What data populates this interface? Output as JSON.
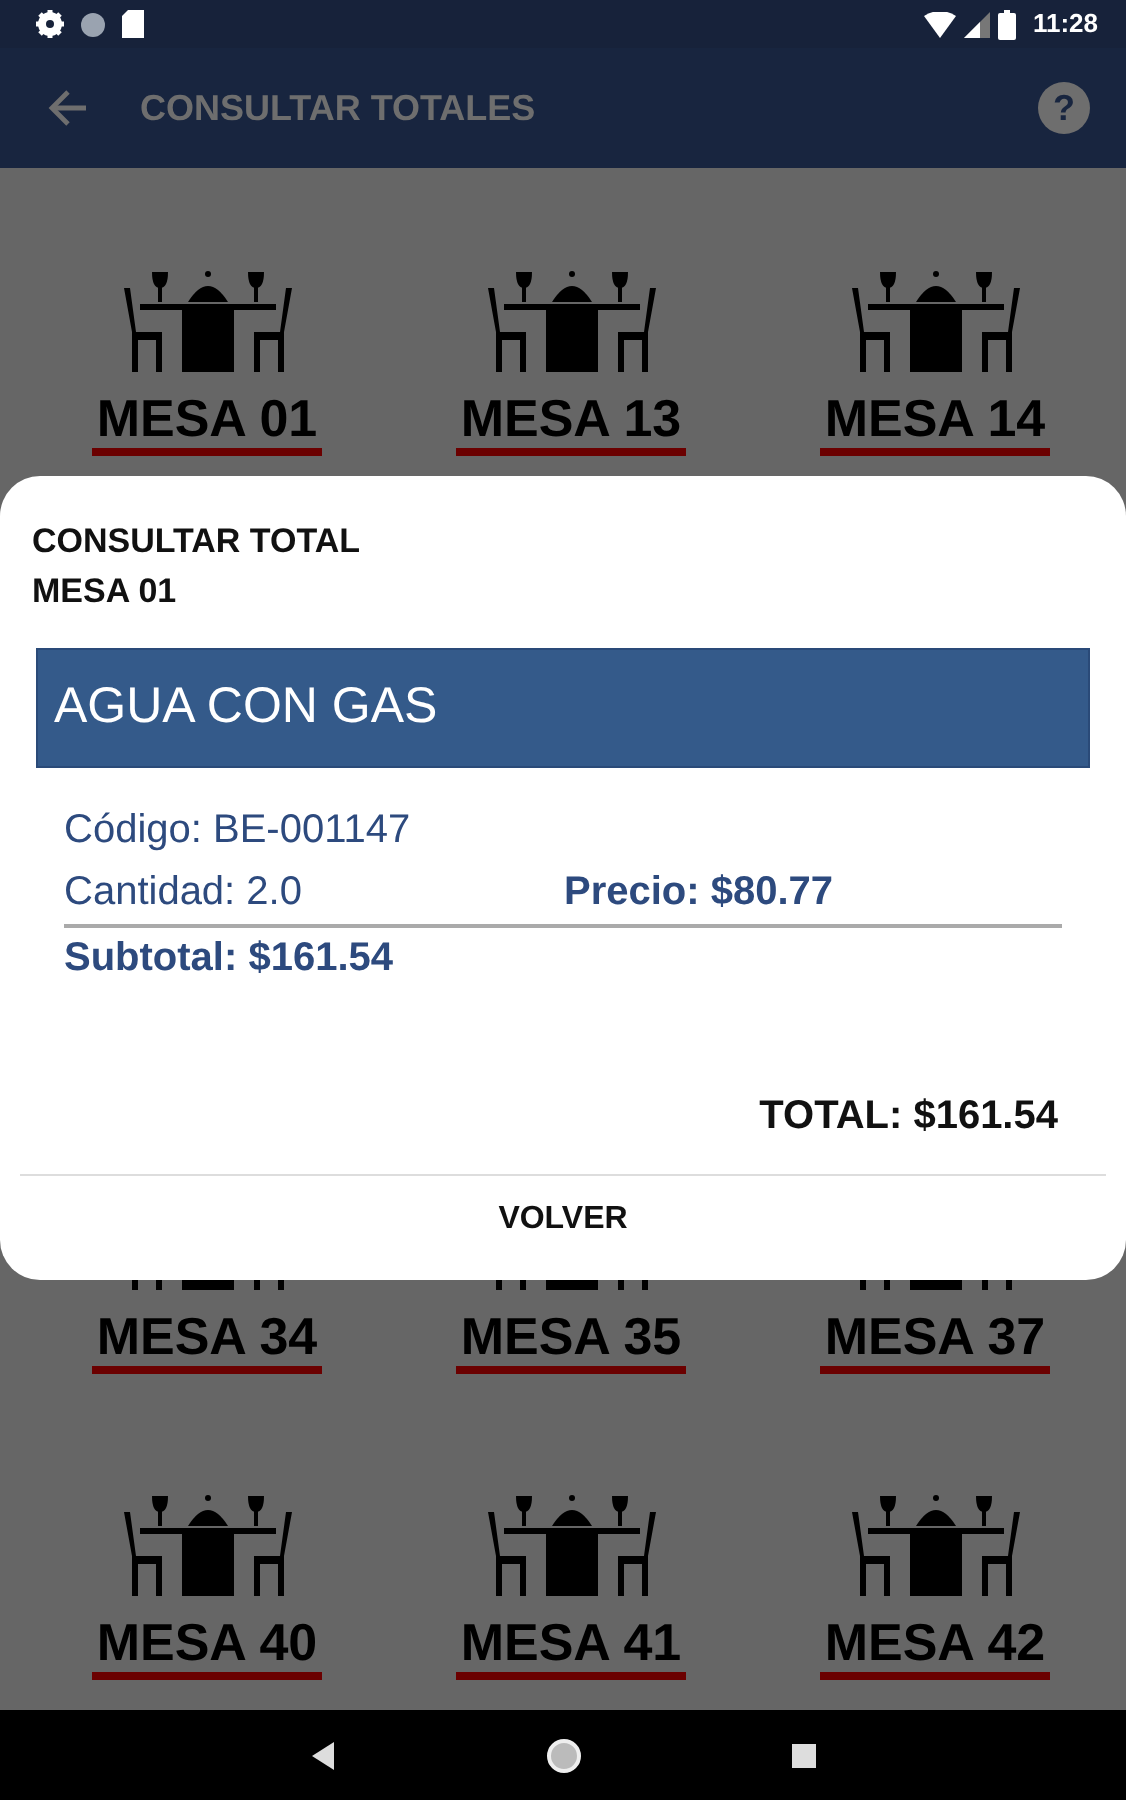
{
  "status_bar": {
    "time": "11:28"
  },
  "app_bar": {
    "title": "CONSULTAR TOTALES",
    "help": "?"
  },
  "table_groups": [
    {
      "rows": [
        [
          "MESA 01",
          "MESA 13",
          "MESA 14"
        ]
      ]
    },
    {
      "rows": [
        [
          "MESA 34",
          "MESA 35",
          "MESA 37"
        ],
        [
          "MESA 40",
          "MESA 41",
          "MESA 42"
        ]
      ]
    }
  ],
  "dialog": {
    "title": "CONSULTAR TOTAL",
    "subtitle": "MESA 01",
    "items": [
      {
        "name": "AGUA CON GAS",
        "code": "Código: BE-001147",
        "quantity": "Cantidad: 2.0",
        "price": "Precio: $80.77",
        "subtotal": "Subtotal: $161.54"
      }
    ],
    "total": "TOTAL: $161.54",
    "button": "VOLVER"
  }
}
